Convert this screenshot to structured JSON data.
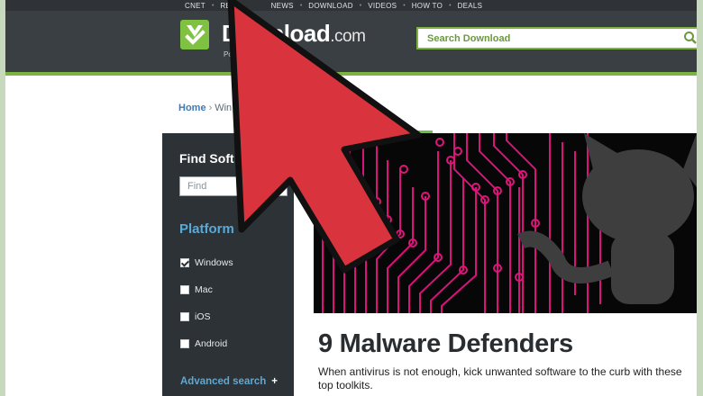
{
  "topnav": {
    "items": [
      "CNET",
      "RE",
      "NEWS",
      "DOWNLOAD",
      "VIDEOS",
      "HOW TO",
      "DEALS"
    ]
  },
  "header": {
    "logo_text": "Download",
    "logo_dotcom": ".com",
    "logo_sub": "Pow",
    "search_placeholder": "Search Download"
  },
  "breadcrumb": {
    "home": "Home",
    "next": "Win"
  },
  "sidebar": {
    "title": "Find Soft",
    "find_placeholder": "Find",
    "platform_title": "Platform",
    "platforms": [
      {
        "label": "Windows",
        "checked": true
      },
      {
        "label": "Mac",
        "checked": false
      },
      {
        "label": "iOS",
        "checked": false
      },
      {
        "label": "Android",
        "checked": false
      }
    ],
    "advanced_search": "Advanced search",
    "advanced_plus": "+"
  },
  "article": {
    "title": "9 Malware Defenders",
    "description": "When antivirus is not enough, kick unwanted software to the curb with these top toolkits."
  },
  "colors": {
    "accent_green": "#7cb342",
    "header_dark": "#3a3f43",
    "sidebar_dark": "#2c3236",
    "link_blue": "#5ba9d6",
    "cursor_red": "#d9333d",
    "circuit_magenta": "#e0157a"
  },
  "icons": {
    "logo": "download-check-icon",
    "search": "search-icon",
    "cursor": "arrow-cursor-icon"
  }
}
